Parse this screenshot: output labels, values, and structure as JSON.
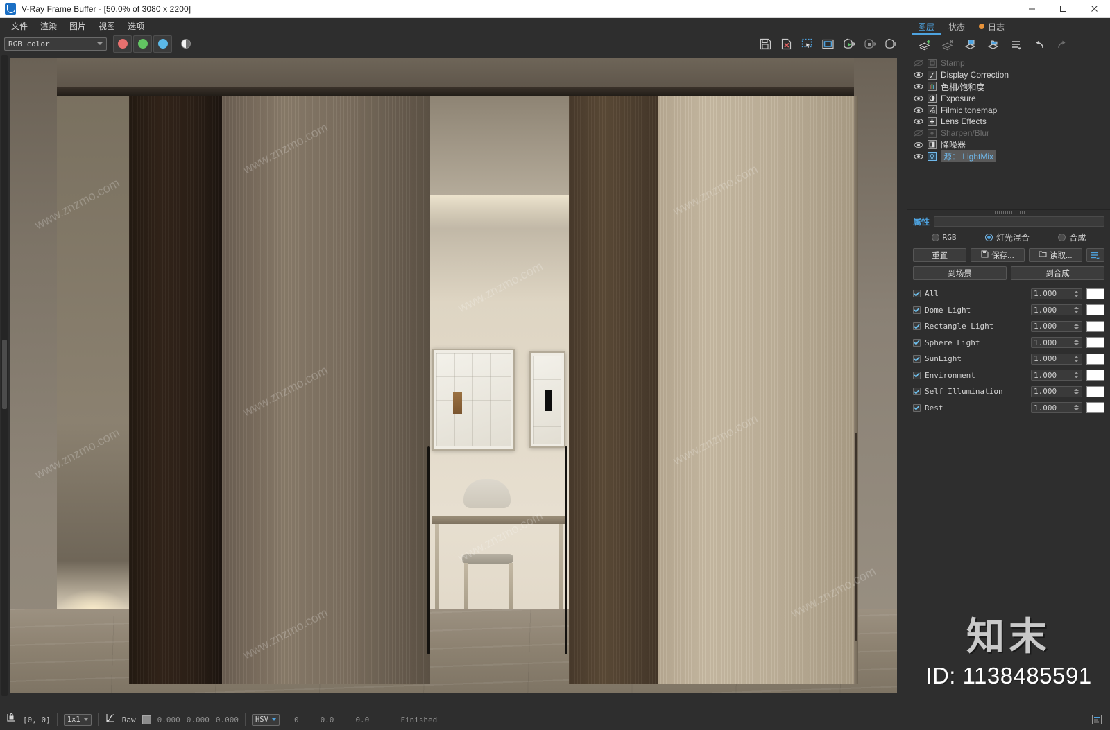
{
  "window": {
    "title": "V-Ray Frame Buffer - [50.0% of 3080 x 2200]",
    "app_icon": "vray-icon",
    "minimize": "–",
    "maximize": "☐",
    "close": "✕"
  },
  "menubar": {
    "items": [
      {
        "label": "文件",
        "name": "menu-file"
      },
      {
        "label": "渲染",
        "name": "menu-render"
      },
      {
        "label": "图片",
        "name": "menu-image"
      },
      {
        "label": "视图",
        "name": "menu-view"
      },
      {
        "label": "选项",
        "name": "menu-options"
      }
    ]
  },
  "toolbar": {
    "channel_value": "RGB color",
    "channels": [
      {
        "name": "red-channel-button",
        "color": "#e8706e"
      },
      {
        "name": "green-channel-button",
        "color": "#62c462"
      },
      {
        "name": "blue-channel-button",
        "color": "#5bb8e8"
      }
    ],
    "alpha_button": "alpha-channel-button",
    "right_icons": [
      "save-image-icon",
      "clear-image-icon",
      "region-render-icon",
      "viewport-icon",
      "render-start-icon",
      "render-stop-icon",
      "render-last-icon"
    ]
  },
  "render_view": {
    "zoom_label": "50.0%",
    "resolution": "3080 x 2200",
    "scene_description": "Interior render of sliding wood panel doors with dining room beyond",
    "watermark_text": "www.znzmo.com"
  },
  "right_panel": {
    "tabs": [
      {
        "label": "图层",
        "name": "tab-layers",
        "active": true
      },
      {
        "label": "状态",
        "name": "tab-status",
        "active": false
      },
      {
        "label": "日志",
        "name": "tab-log",
        "active": false,
        "dot": true
      }
    ],
    "tools": [
      "add-layer-icon",
      "delete-layer-icon",
      "save-layers-icon",
      "load-layers-icon",
      "layer-menu-icon",
      "undo-icon",
      "redo-icon"
    ],
    "layers": [
      {
        "label": "Stamp",
        "icon": "stamp-icon",
        "enabled": false,
        "selected": false
      },
      {
        "label": "Display Correction",
        "icon": "curve-icon",
        "enabled": true,
        "selected": false
      },
      {
        "label": "色相/饱和度",
        "icon": "hue-saturation-icon",
        "enabled": true,
        "selected": false
      },
      {
        "label": "Exposure",
        "icon": "exposure-icon",
        "enabled": true,
        "selected": false
      },
      {
        "label": "Filmic tonemap",
        "icon": "filmic-icon",
        "enabled": true,
        "selected": false
      },
      {
        "label": "Lens Effects",
        "icon": "lens-effects-icon",
        "enabled": true,
        "selected": false
      },
      {
        "label": "Sharpen/Blur",
        "icon": "sharpen-blur-icon",
        "enabled": false,
        "selected": false
      },
      {
        "label": "降噪器",
        "icon": "denoiser-icon",
        "enabled": true,
        "selected": false
      },
      {
        "label": "源： LightMix",
        "icon": "lightmix-icon",
        "enabled": true,
        "selected": true
      }
    ],
    "properties": {
      "title": "属性",
      "modes": [
        {
          "label": "RGB",
          "name": "radio-rgb",
          "selected": false,
          "mono": true
        },
        {
          "label": "灯光混合",
          "name": "radio-lightmix",
          "selected": true,
          "mono": false
        },
        {
          "label": "合成",
          "name": "radio-composite",
          "selected": false,
          "mono": false
        }
      ],
      "buttons": {
        "reset": "重置",
        "save": "保存...",
        "load": "读取...",
        "menu": "options-menu-icon",
        "to_scene": "到场景",
        "to_composite": "到合成"
      },
      "lightmix_rows": [
        {
          "label": "All",
          "value": "1.000",
          "checked": true,
          "color": "#ffffff"
        },
        {
          "label": "Dome Light",
          "value": "1.000",
          "checked": true,
          "color": "#ffffff"
        },
        {
          "label": "Rectangle Light",
          "value": "1.000",
          "checked": true,
          "color": "#ffffff"
        },
        {
          "label": "Sphere Light",
          "value": "1.000",
          "checked": true,
          "color": "#ffffff"
        },
        {
          "label": "SunLight",
          "value": "1.000",
          "checked": true,
          "color": "#ffffff"
        },
        {
          "label": "Environment",
          "value": "1.000",
          "checked": true,
          "color": "#ffffff"
        },
        {
          "label": "Self Illumination",
          "value": "1.000",
          "checked": true,
          "color": "#ffffff"
        },
        {
          "label": "Rest",
          "value": "1.000",
          "checked": true,
          "color": "#ffffff"
        }
      ]
    },
    "watermark": {
      "logo": "知末",
      "id": "ID: 1138485591"
    }
  },
  "statusbar": {
    "lock_icon": "pixel-lock-icon",
    "coords": "[0,  0]",
    "sample_size": "1x1",
    "curve_icon": "color-curve-icon",
    "raw_label": "Raw",
    "color_values": [
      "0.000",
      "0.000",
      "0.000"
    ],
    "color_mode": "HSV",
    "hsv_values": [
      "0",
      "0.0",
      "0.0"
    ],
    "state": "Finished",
    "right_icon": "log-lines-icon"
  }
}
